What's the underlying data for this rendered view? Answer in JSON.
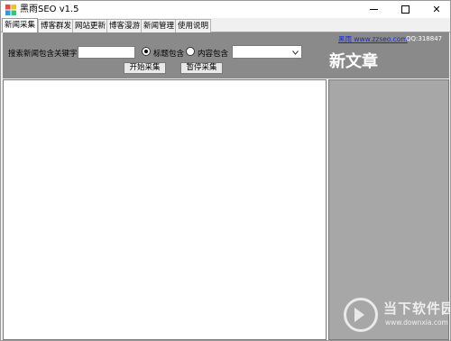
{
  "window": {
    "title": "黑雨SEO v1.5",
    "controls": {
      "minimize": "minimize",
      "maximize": "maximize",
      "close": "✕"
    }
  },
  "tabs": [
    {
      "label": "新闻采集",
      "active": true
    },
    {
      "label": "博客群发",
      "active": false
    },
    {
      "label": "网站更新",
      "active": false
    },
    {
      "label": "博客漫游",
      "active": false
    },
    {
      "label": "新闻管理",
      "active": false
    },
    {
      "label": "使用说明",
      "active": false
    }
  ],
  "toolbar": {
    "keyword_label": "搜索新闻包含关键字",
    "keyword_value": "",
    "radio_title": {
      "label": "标题包含",
      "checked": true
    },
    "radio_content": {
      "label": "内容包含",
      "checked": false
    },
    "select_value": "",
    "start_button": "开始采集",
    "pause_button": "暂停采集",
    "site_link": "黑雨 www.zzseo.com",
    "qq": "QQ:318847",
    "new_articles": "新文章"
  },
  "watermark": {
    "name": "当下软件园",
    "url": "www.downxia.com"
  },
  "colors": {
    "toolbar_bg": "#8a8a8a",
    "side_panel_bg": "#a7a7a7",
    "link": "#1a2ad6"
  }
}
